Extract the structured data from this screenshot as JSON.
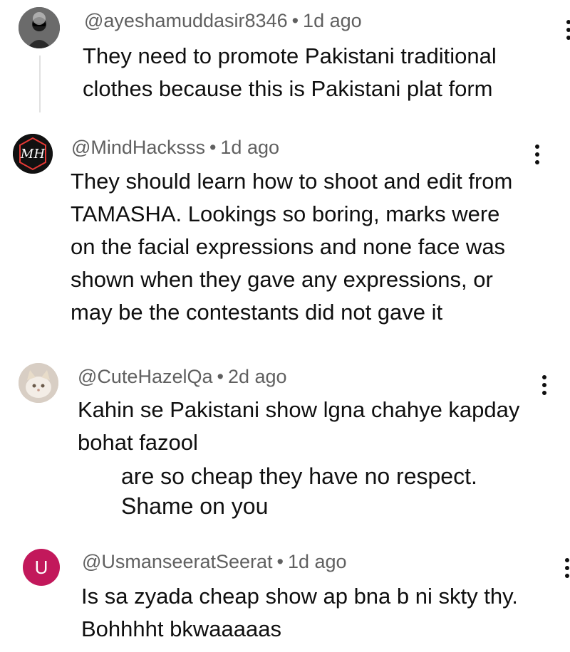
{
  "comments": [
    {
      "handle": "@ayeshamuddasir8346",
      "age": "1d ago",
      "lines": [
        "They need to promote Pakistani traditional",
        "clothes because this is Pakistani plat form"
      ]
    },
    {
      "handle": "@MindHacksss",
      "age": "1d ago",
      "avatar_text": "MH",
      "lines": [
        "They should learn how to shoot and edit from",
        "TAMASHA. Lookings so boring, marks were",
        "on the facial expressions and none face was",
        "shown when they gave any expressions, or",
        "may be the contestants did not gave it"
      ]
    },
    {
      "handle": "@CuteHazelQa",
      "age": "2d ago",
      "lines": [
        "Kahin se Pakistani show lgna chahye kapday",
        "bohat fazool"
      ]
    },
    {
      "handle": "@UsmanseeratSeerat",
      "age": "1d ago",
      "avatar_letter": "U",
      "avatar_color": "#c2185b",
      "lines": [
        "Is sa zyada cheap show ap bna b ni skty thy.",
        "Bohhhht bkwaaaaas"
      ]
    }
  ],
  "overlay": {
    "lines": [
      "are so cheap they have no respect.",
      "Shame on you"
    ]
  },
  "separator": "•",
  "icons": [
    "more-vert-icon"
  ]
}
